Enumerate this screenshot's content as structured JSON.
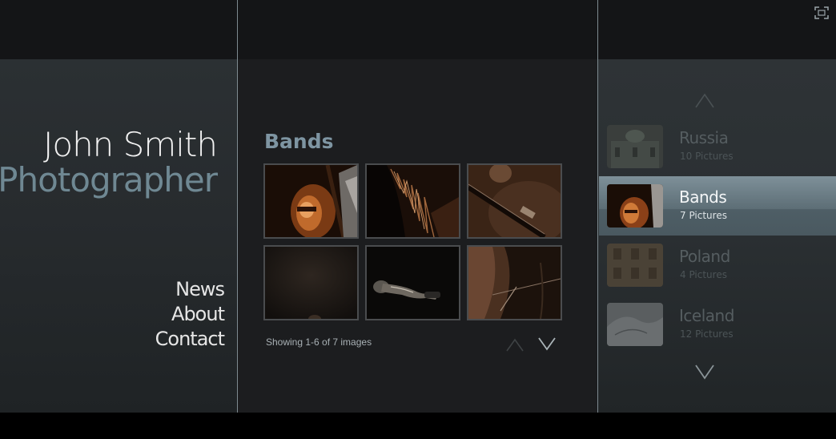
{
  "header": {
    "name": "John Smith",
    "title": "Photographer"
  },
  "nav": {
    "items": [
      {
        "label": "News"
      },
      {
        "label": "About"
      },
      {
        "label": "Contact"
      }
    ]
  },
  "gallery": {
    "album_title": "Bands",
    "status_text": "Showing 1-6 of 7 images",
    "thumbnails": [
      {
        "subject": "guitarist with glasses"
      },
      {
        "subject": "backlit hair"
      },
      {
        "subject": "guitar neck"
      },
      {
        "subject": "dark stage"
      },
      {
        "subject": "hand with microphone"
      },
      {
        "subject": "guitar strings"
      }
    ]
  },
  "albums": [
    {
      "name": "Russia",
      "count": "10 Pictures",
      "active": false
    },
    {
      "name": "Bands",
      "count": "7 Pictures",
      "active": true
    },
    {
      "name": "Poland",
      "count": "4 Pictures",
      "active": false
    },
    {
      "name": "Iceland",
      "count": "12 Pictures",
      "active": false
    }
  ],
  "colors": {
    "accent": "#7e95a2",
    "active_album": "#5d6e76",
    "panel_dark": "#1c1d1f"
  }
}
